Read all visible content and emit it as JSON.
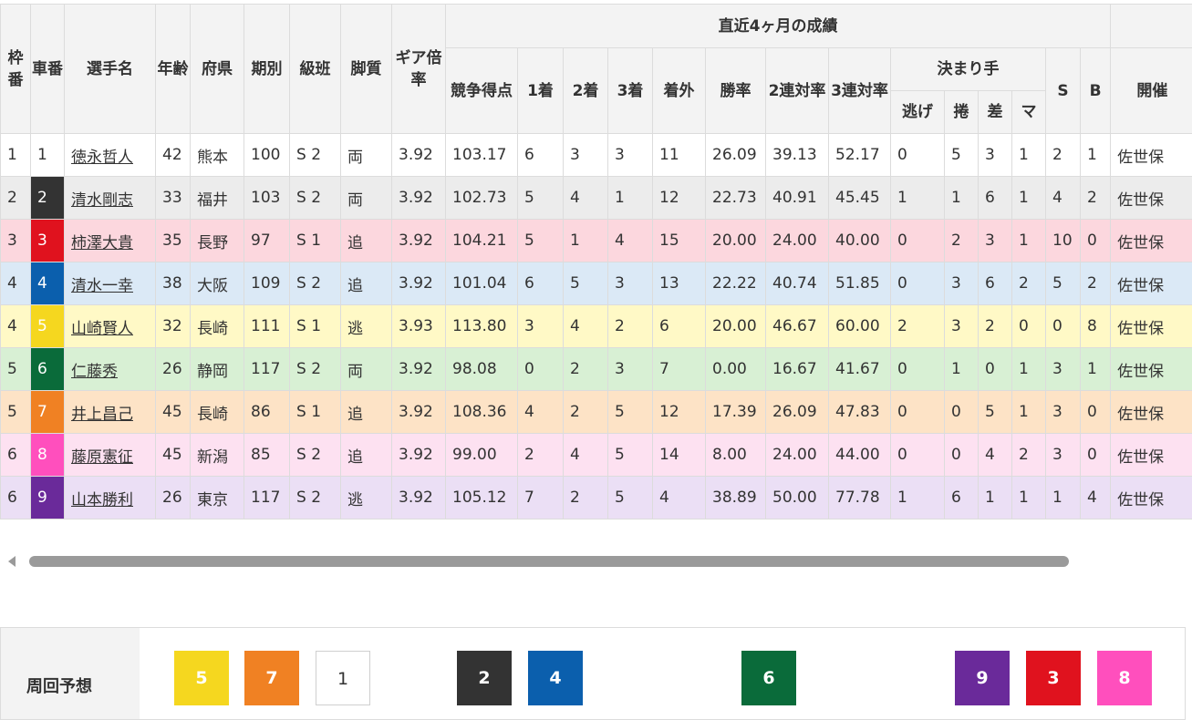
{
  "header": {
    "waku": "枠番",
    "car": "車番",
    "name": "選手名",
    "age": "年齢",
    "pref": "府県",
    "term": "期別",
    "rank": "級班",
    "style": "脚質",
    "gear": "ギア倍率",
    "recent": "直近4ヶ月の成績",
    "score": "競争得点",
    "first": "1着",
    "second": "2着",
    "third": "3着",
    "out": "着外",
    "win_rate": "勝率",
    "quin_rate": "2連対率",
    "trio_rate": "3連対率",
    "kimarite": "決まり手",
    "nige": "逃げ",
    "makuri": "捲",
    "sashi": "差",
    "mark": "マ",
    "s": "S",
    "b": "B",
    "venue": "開催"
  },
  "rows": [
    {
      "waku": "1",
      "car": "1",
      "name": "徳永哲人",
      "age": "42",
      "pref": "熊本",
      "term": "100",
      "rank": "S 2",
      "style": "両",
      "gear": "3.92",
      "score": "103.17",
      "first": "6",
      "second": "3",
      "third": "3",
      "out": "11",
      "win": "26.09",
      "quin": "39.13",
      "trio": "52.17",
      "nige": "0",
      "makuri": "5",
      "sashi": "3",
      "mark": "1",
      "s": "2",
      "b": "1",
      "venue": "佐世保"
    },
    {
      "waku": "2",
      "car": "2",
      "name": "清水剛志",
      "age": "33",
      "pref": "福井",
      "term": "103",
      "rank": "S 2",
      "style": "両",
      "gear": "3.92",
      "score": "102.73",
      "first": "5",
      "second": "4",
      "third": "1",
      "out": "12",
      "win": "22.73",
      "quin": "40.91",
      "trio": "45.45",
      "nige": "1",
      "makuri": "1",
      "sashi": "6",
      "mark": "1",
      "s": "4",
      "b": "2",
      "venue": "佐世保"
    },
    {
      "waku": "3",
      "car": "3",
      "name": "柿澤大貴",
      "age": "35",
      "pref": "長野",
      "term": "97",
      "rank": "S 1",
      "style": "追",
      "gear": "3.92",
      "score": "104.21",
      "first": "5",
      "second": "1",
      "third": "4",
      "out": "15",
      "win": "20.00",
      "quin": "24.00",
      "trio": "40.00",
      "nige": "0",
      "makuri": "2",
      "sashi": "3",
      "mark": "1",
      "s": "10",
      "b": "0",
      "venue": "佐世保"
    },
    {
      "waku": "4",
      "car": "4",
      "name": "清水一幸",
      "age": "38",
      "pref": "大阪",
      "term": "109",
      "rank": "S 2",
      "style": "追",
      "gear": "3.92",
      "score": "101.04",
      "first": "6",
      "second": "5",
      "third": "3",
      "out": "13",
      "win": "22.22",
      "quin": "40.74",
      "trio": "51.85",
      "nige": "0",
      "makuri": "3",
      "sashi": "6",
      "mark": "2",
      "s": "5",
      "b": "2",
      "venue": "佐世保"
    },
    {
      "waku": "4",
      "car": "5",
      "name": "山崎賢人",
      "age": "32",
      "pref": "長崎",
      "term": "111",
      "rank": "S 1",
      "style": "逃",
      "gear": "3.93",
      "score": "113.80",
      "first": "3",
      "second": "4",
      "third": "2",
      "out": "6",
      "win": "20.00",
      "quin": "46.67",
      "trio": "60.00",
      "nige": "2",
      "makuri": "3",
      "sashi": "2",
      "mark": "0",
      "s": "0",
      "b": "8",
      "venue": "佐世保"
    },
    {
      "waku": "5",
      "car": "6",
      "name": "仁藤秀",
      "age": "26",
      "pref": "静岡",
      "term": "117",
      "rank": "S 2",
      "style": "両",
      "gear": "3.92",
      "score": "98.08",
      "first": "0",
      "second": "2",
      "third": "3",
      "out": "7",
      "win": "0.00",
      "quin": "16.67",
      "trio": "41.67",
      "nige": "0",
      "makuri": "1",
      "sashi": "0",
      "mark": "1",
      "s": "3",
      "b": "1",
      "venue": "佐世保"
    },
    {
      "waku": "5",
      "car": "7",
      "name": "井上昌己",
      "age": "45",
      "pref": "長崎",
      "term": "86",
      "rank": "S 1",
      "style": "追",
      "gear": "3.92",
      "score": "108.36",
      "first": "4",
      "second": "2",
      "third": "5",
      "out": "12",
      "win": "17.39",
      "quin": "26.09",
      "trio": "47.83",
      "nige": "0",
      "makuri": "0",
      "sashi": "5",
      "mark": "1",
      "s": "3",
      "b": "0",
      "venue": "佐世保"
    },
    {
      "waku": "6",
      "car": "8",
      "name": "藤原憲征",
      "age": "45",
      "pref": "新潟",
      "term": "85",
      "rank": "S 2",
      "style": "追",
      "gear": "3.92",
      "score": "99.00",
      "first": "2",
      "second": "4",
      "third": "5",
      "out": "14",
      "win": "8.00",
      "quin": "24.00",
      "trio": "44.00",
      "nige": "0",
      "makuri": "0",
      "sashi": "4",
      "mark": "2",
      "s": "3",
      "b": "0",
      "venue": "佐世保"
    },
    {
      "waku": "6",
      "car": "9",
      "name": "山本勝利",
      "age": "26",
      "pref": "東京",
      "term": "117",
      "rank": "S 2",
      "style": "逃",
      "gear": "3.92",
      "score": "105.12",
      "first": "7",
      "second": "2",
      "third": "5",
      "out": "4",
      "win": "38.89",
      "quin": "50.00",
      "trio": "77.78",
      "nige": "1",
      "makuri": "6",
      "sashi": "1",
      "mark": "1",
      "s": "1",
      "b": "4",
      "venue": "佐世保"
    }
  ],
  "car_colors": {
    "1": "#ffffff",
    "2": "#333333",
    "3": "#e0121e",
    "4": "#0b5fad",
    "5": "#f5d71f",
    "6": "#0a6b3a",
    "7": "#f08123",
    "8": "#ff4fbd",
    "9": "#6a2a9a"
  },
  "prediction": {
    "label": "周回予想",
    "chips": [
      {
        "num": "5",
        "color": "#f5d71f"
      },
      {
        "num": "7",
        "color": "#f08123"
      },
      {
        "num": "1",
        "color": "#ffffff"
      },
      {
        "num": "2",
        "color": "#333333"
      },
      {
        "num": "4",
        "color": "#0b5fad"
      },
      {
        "num": "6",
        "color": "#0a6b3a"
      },
      {
        "num": "9",
        "color": "#6a2a9a"
      },
      {
        "num": "3",
        "color": "#e0121e"
      },
      {
        "num": "8",
        "color": "#ff4fbd"
      }
    ]
  }
}
